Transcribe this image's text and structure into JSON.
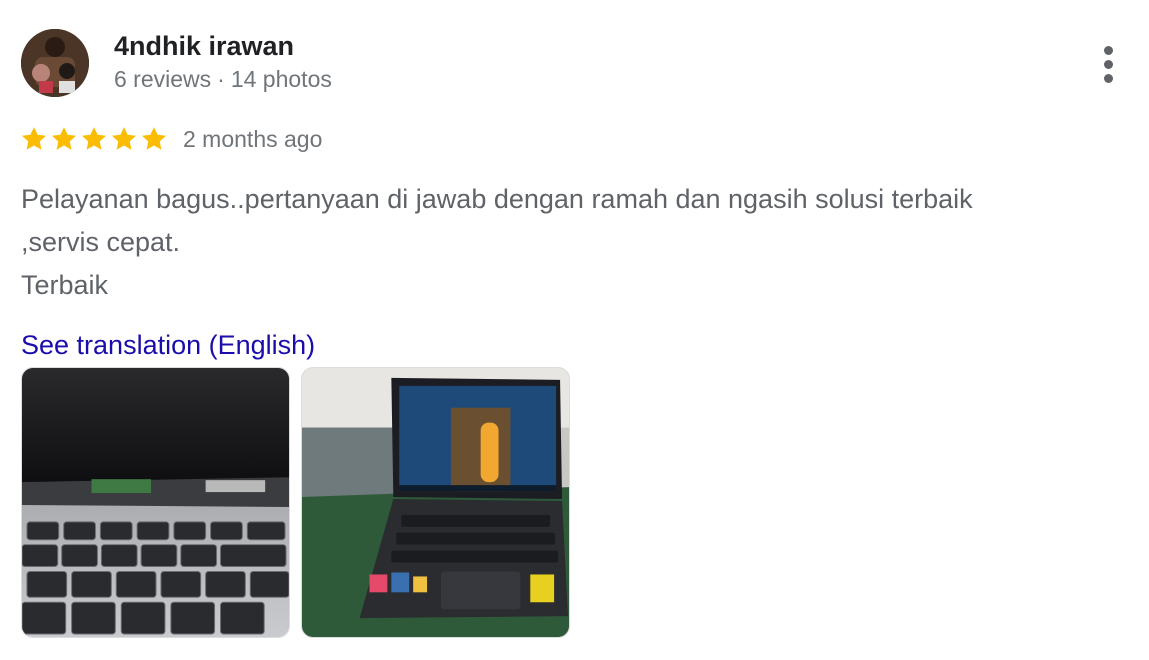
{
  "author": {
    "name": "4ndhik irawan",
    "reviews": "6 reviews",
    "separator": "·",
    "photos": "14 photos"
  },
  "rating": {
    "stars": 5,
    "max_stars": 5,
    "star_color": "#fbbc04",
    "date": "2 months ago"
  },
  "review_text": {
    "line1": "Pelayanan bagus..pertanyaan di jawab dengan ramah dan ngasih solusi terbaik",
    "line2": ",servis cepat.",
    "line3": "Terbaik"
  },
  "translation_link": "See translation (English)",
  "colors": {
    "name": "#202124",
    "meta": "#70757a",
    "body": "#5f6368",
    "link": "#1a0dab"
  },
  "icons": {
    "more": "more-vert-icon",
    "star": "star-icon"
  },
  "photos": [
    {
      "subject": "laptop-keyboard-closeup"
    },
    {
      "subject": "laptop-on-workbench"
    }
  ]
}
